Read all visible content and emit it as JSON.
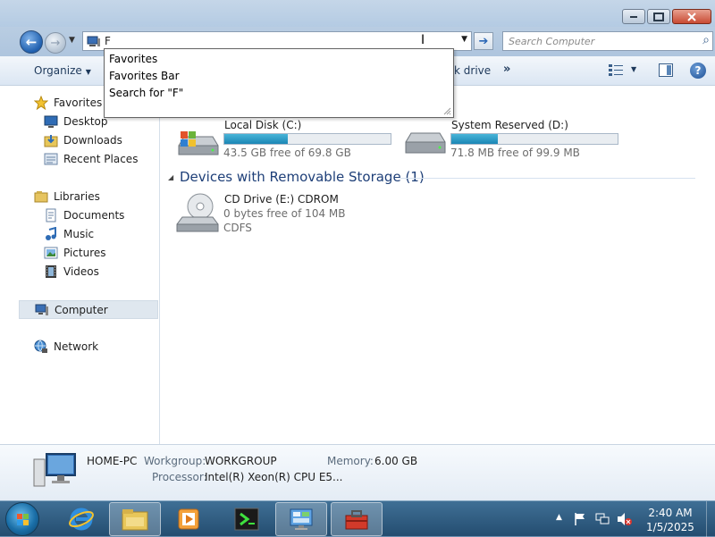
{
  "address_bar": {
    "back_glyph": "←",
    "forward_glyph": "→",
    "value": "F",
    "go_glyph": "➔"
  },
  "search": {
    "placeholder": "Search Computer"
  },
  "toolbar": {
    "organize_label": "Organize",
    "partial_label": "k drive",
    "more_label": "»",
    "help_label": "?"
  },
  "autocomplete": {
    "items": [
      "Favorites",
      "Favorites Bar",
      "Search for \"F\""
    ]
  },
  "nav": {
    "favorites": "Favorites",
    "desktop": "Desktop",
    "downloads": "Downloads",
    "recent_places": "Recent Places",
    "libraries": "Libraries",
    "documents": "Documents",
    "music": "Music",
    "pictures": "Pictures",
    "videos": "Videos",
    "computer": "Computer",
    "network": "Network"
  },
  "drives": [
    {
      "name": "Local Disk (C:)",
      "free_text": "43.5 GB free of 69.8 GB",
      "used_fraction": 0.38
    },
    {
      "name": "System Reserved (D:)",
      "free_text": "71.8 MB free of 99.9 MB",
      "used_fraction": 0.28
    }
  ],
  "removable_group": {
    "title": "Devices with Removable Storage (1)",
    "device_name": "CD Drive (E:) CDROM",
    "device_free": "0 bytes free of 104 MB",
    "device_fs": "CDFS"
  },
  "details": {
    "computer_name": "HOME-PC",
    "workgroup_label": "Workgroup:",
    "workgroup_value": "WORKGROUP",
    "memory_label": "Memory:",
    "memory_value": "6.00 GB",
    "processor_label": "Processor:",
    "processor_value": "Intel(R) Xeon(R) CPU E5..."
  },
  "taskbar": {
    "time": "2:40 AM",
    "date": "1/5/2025",
    "tray_arrow": "▲"
  },
  "colors": {
    "accent": "#1e3f78",
    "bar_fill": "#1b86b5",
    "taskbar": "#2e5a7f"
  }
}
